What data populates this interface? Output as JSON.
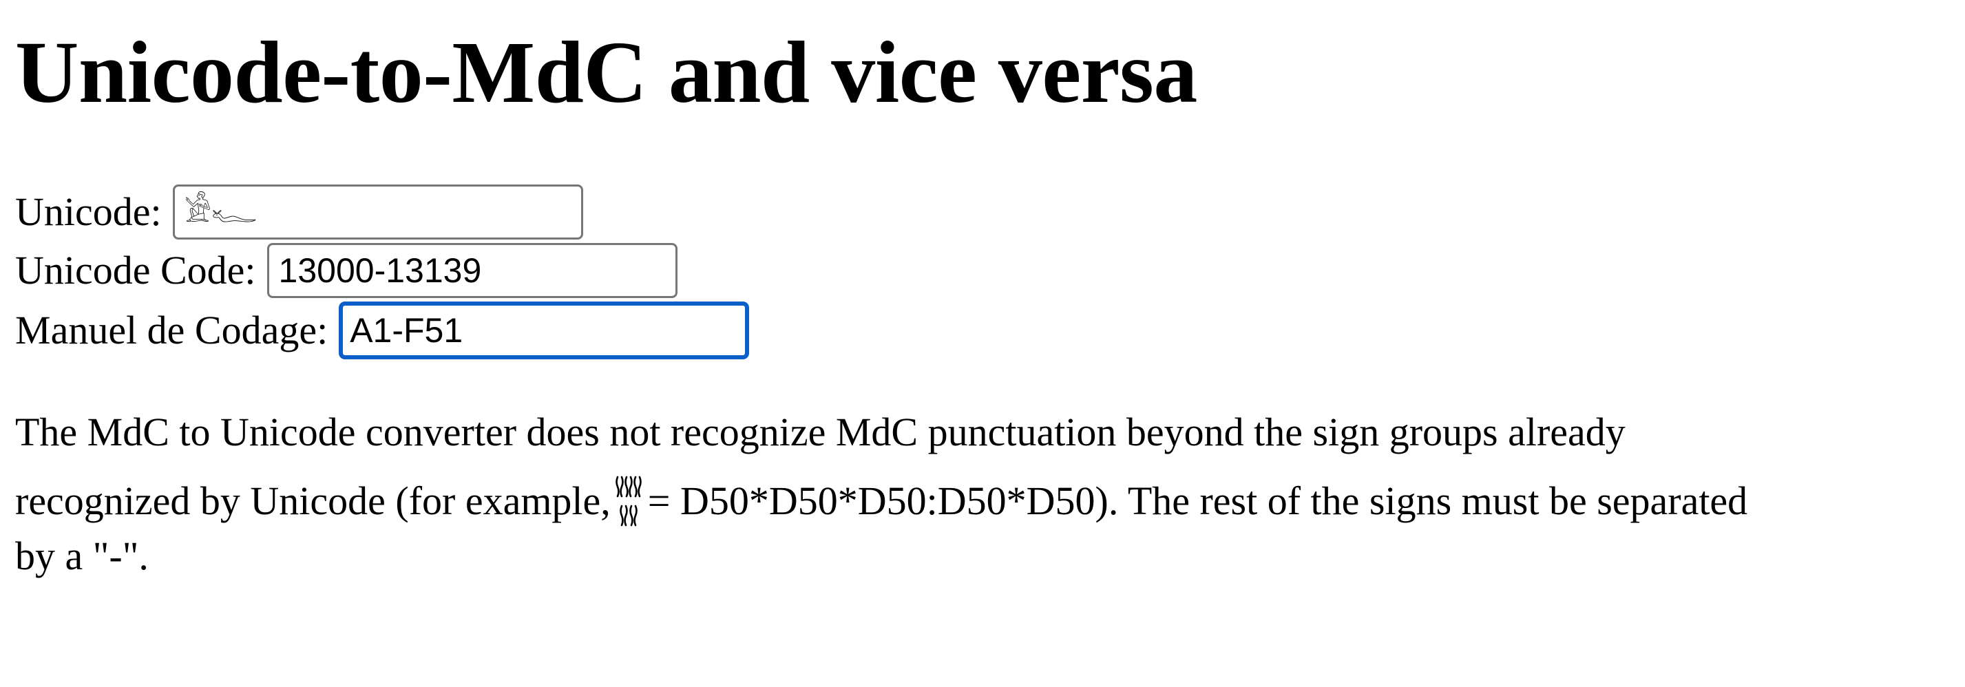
{
  "page": {
    "title": "Unicode-to-MdC and vice versa"
  },
  "form": {
    "unicode": {
      "label": "Unicode:",
      "value": "𓀀𓆑"
    },
    "unicode_code": {
      "label": "Unicode Code:",
      "value": "13000-13139"
    },
    "mdc": {
      "label": "Manuel de Codage:",
      "value": "A1-F51",
      "focused": true
    }
  },
  "note": {
    "line1": "The MdC to Unicode converter does not recognize MdC punctuation beyond the sign groups already",
    "line2_before": "recognized by Unicode (for example,",
    "line2_glyph_icon": "d50-sign-group-icon",
    "line2_after": "= D50*D50*D50:D50*D50). The rest of the signs must be separated",
    "line3": "by a \"-\"."
  },
  "colors": {
    "focus_border": "#0b5fc9",
    "field_border": "#767676",
    "text": "#000000",
    "background": "#ffffff"
  }
}
